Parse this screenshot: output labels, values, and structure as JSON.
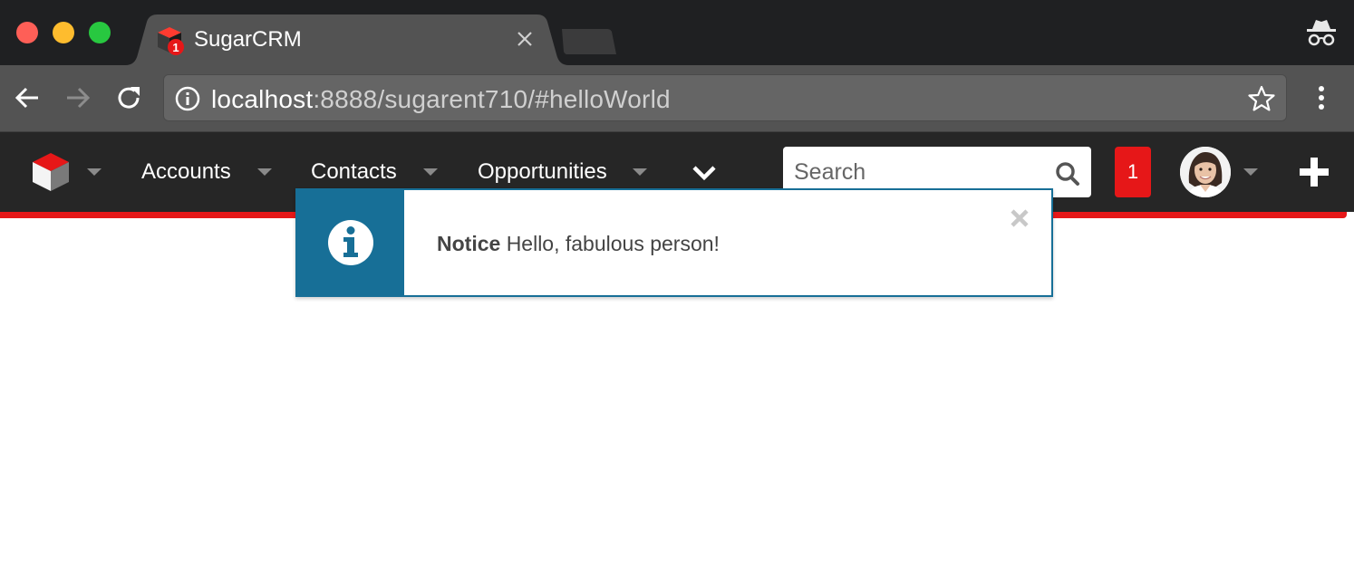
{
  "browser": {
    "tab_title": "SugarCRM",
    "url_host": "localhost",
    "url_rest": ":8888/sugarent710/#helloWorld",
    "favicon_badge": "1"
  },
  "navbar": {
    "modules": [
      {
        "label": "Accounts"
      },
      {
        "label": "Contacts"
      },
      {
        "label": "Opportunities"
      }
    ],
    "search_placeholder": "Search",
    "notification_count": "1"
  },
  "alert": {
    "title": "Notice",
    "message": "Hello, fabulous person!"
  },
  "colors": {
    "brand_red": "#e61718",
    "alert_blue": "#176f97",
    "nav_bg": "#262626"
  }
}
